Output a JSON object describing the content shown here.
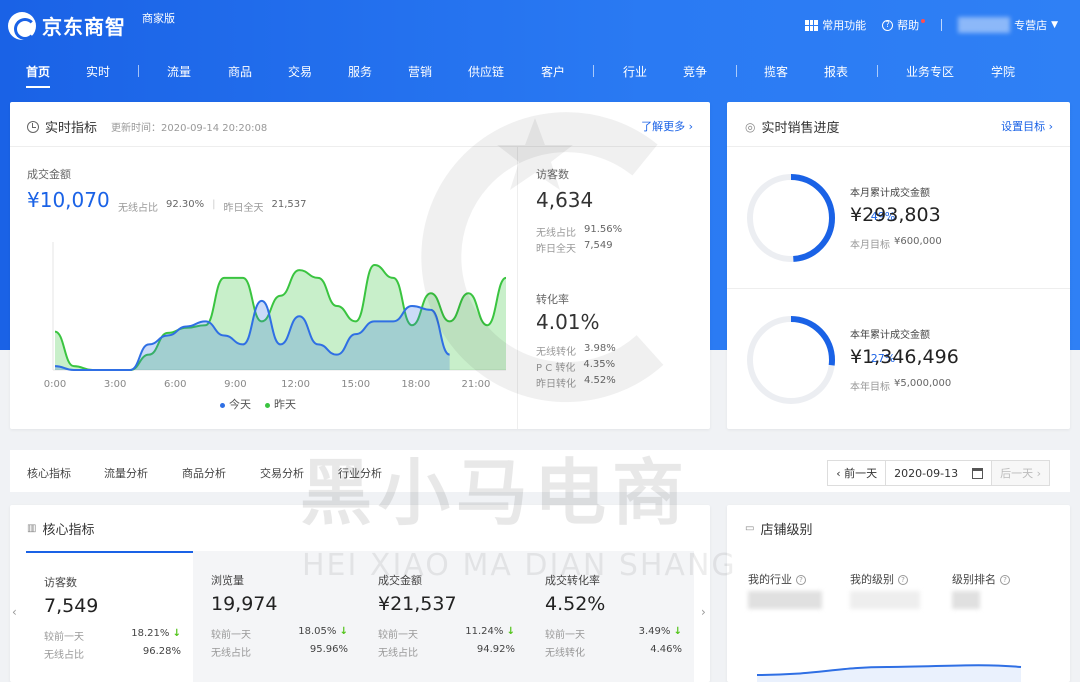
{
  "header": {
    "logo_text": "京东商智",
    "badge": "商家版",
    "common_functions": "常用功能",
    "help": "帮助",
    "store_suffix": "专营店"
  },
  "nav": [
    "首页",
    "实时",
    "流量",
    "商品",
    "交易",
    "服务",
    "营销",
    "供应链",
    "客户",
    "行业",
    "竞争",
    "揽客",
    "报表",
    "业务专区",
    "学院"
  ],
  "realtime": {
    "title": "实时指标",
    "updated": "更新时间：2020-09-14 20:20:08",
    "more": "了解更多 ›",
    "gmv_label": "成交金额",
    "gmv_value": "¥10,070",
    "wireless_label": "无线占比",
    "wireless_value": "92.30%",
    "yesterday_label": "昨日全天",
    "yesterday_value": "21,537",
    "visitors_label": "访客数",
    "visitors_value": "4,634",
    "vis_wireless_label": "无线占比",
    "vis_wireless_value": "91.56%",
    "vis_yesterday_label": "昨日全天",
    "vis_yesterday_value": "7,549",
    "conv_label": "转化率",
    "conv_value": "4.01%",
    "conv_wireless_label": "无线转化",
    "conv_wireless_value": "3.98%",
    "conv_pc_label": "P C 转化",
    "conv_pc_value": "4.35%",
    "conv_yesterday_label": "昨日转化",
    "conv_yesterday_value": "4.52%"
  },
  "chart_data": {
    "type": "area",
    "x": [
      "0:00",
      "3:00",
      "6:00",
      "9:00",
      "12:00",
      "15:00",
      "18:00",
      "21:00"
    ],
    "series": [
      {
        "name": "今天",
        "color": "#2f6fe4",
        "values": [
          0.03,
          0,
          0,
          0,
          0,
          0.2,
          0.27,
          0.34,
          0.38,
          0.27,
          0.2,
          0.54,
          0.2,
          0.42,
          0.2,
          0.12,
          0.28,
          0.38,
          0.38,
          0.5,
          0.47,
          0.12
        ]
      },
      {
        "name": "昨天",
        "color": "#3ac440",
        "values": [
          0.3,
          0.03,
          0,
          0,
          0,
          0.12,
          0.29,
          0.33,
          0.35,
          0.72,
          0.72,
          0.38,
          0.58,
          0.78,
          0.72,
          0.5,
          0.38,
          0.82,
          0.72,
          0.35,
          0.6,
          0.38,
          0.6,
          0.35,
          0.72
        ]
      }
    ],
    "legend_position": "bottom"
  },
  "sales": {
    "title": "实时销售进度",
    "set_goal": "设置目标 ›",
    "month_pct": "49%",
    "month_pct_value": 49,
    "month_label": "本月累计成交金额",
    "month_value": "¥293,803",
    "month_goal_label": "本月目标",
    "month_goal_value": "¥600,000",
    "year_pct": "27%",
    "year_pct_value": 27,
    "year_label": "本年累计成交金额",
    "year_value": "¥1,346,496",
    "year_goal_label": "本年目标",
    "year_goal_value": "¥5,000,000"
  },
  "analysis_tabs": [
    "核心指标",
    "流量分析",
    "商品分析",
    "交易分析",
    "行业分析"
  ],
  "date_ctrl": {
    "prev": "‹ 前一天",
    "date": "2020-09-13",
    "next": "后一天 ›"
  },
  "core": {
    "title": "核心指标",
    "cells": [
      {
        "label": "访客数",
        "value": "7,549",
        "r1_label": "较前一天",
        "r1_value": "18.21%",
        "r2_label": "无线占比",
        "r2_value": "96.28%"
      },
      {
        "label": "浏览量",
        "value": "19,974",
        "r1_label": "较前一天",
        "r1_value": "18.05%",
        "r2_label": "无线占比",
        "r2_value": "95.96%"
      },
      {
        "label": "成交金额",
        "value": "¥21,537",
        "r1_label": "较前一天",
        "r1_value": "11.24%",
        "r2_label": "无线占比",
        "r2_value": "94.92%"
      },
      {
        "label": "成交转化率",
        "value": "4.52%",
        "r1_label": "较前一天",
        "r1_value": "3.49%",
        "r2_label": "无线转化",
        "r2_value": "4.46%"
      }
    ]
  },
  "store_level": {
    "title": "店铺级别",
    "industry": "我的行业",
    "level": "我的级别",
    "rank": "级别排名"
  },
  "watermark": {
    "cn": "黑小马电商",
    "en": "HEI XIAO MA DIAN SHANG"
  },
  "colors": {
    "brand": "#1a62e6",
    "today": "#2f6fe4",
    "yesterday": "#3ac440",
    "up": "#52c41a"
  }
}
